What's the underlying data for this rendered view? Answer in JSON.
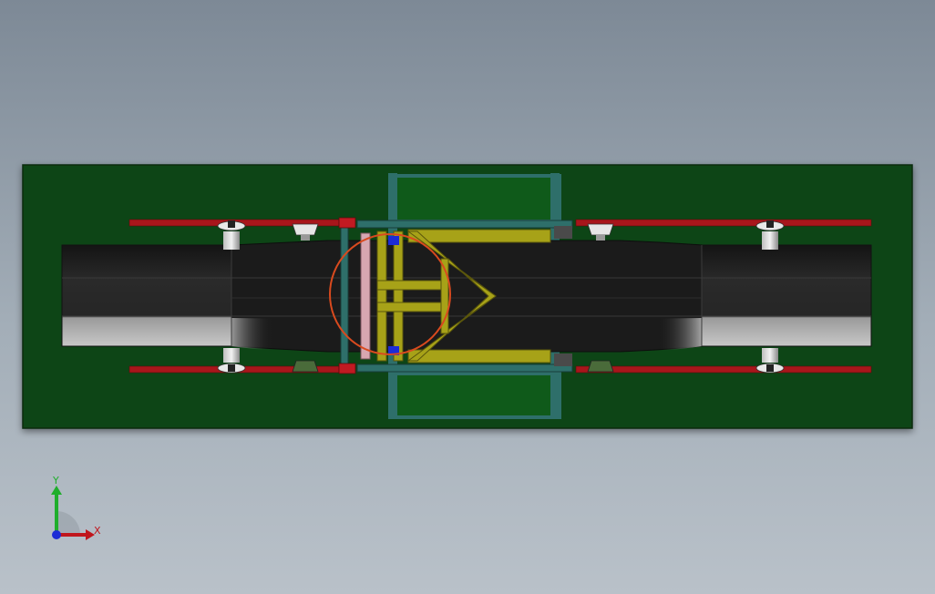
{
  "viewport": {
    "background_top": "#7d8996",
    "background_bottom": "#b9c1c9"
  },
  "model": {
    "base_plate_color": "#0d4415",
    "frame_color": "#2e6f6a",
    "rail_color": "#a8161b",
    "yellow_frame_color": "#a7a218",
    "belt_color": "#1a1a1a",
    "highlight_circle_color": "#d94a1e"
  },
  "triad": {
    "x_label": "X",
    "y_label": "Y",
    "x_color": "#c0161c",
    "y_color": "#1fae2c",
    "z_color": "#1d2bd6"
  }
}
